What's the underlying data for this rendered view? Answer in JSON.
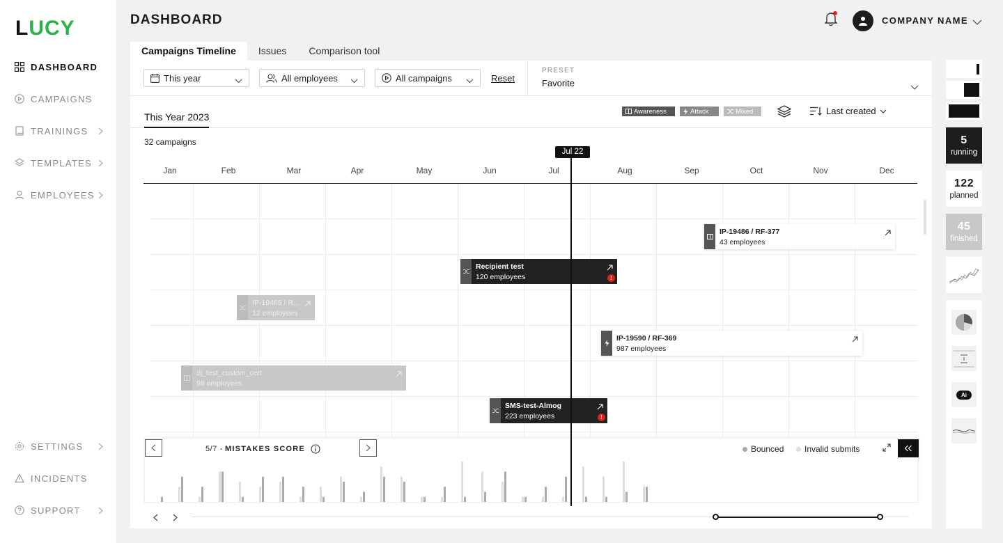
{
  "brand": {
    "logo_first": "L",
    "logo_rest": "UCY",
    "accent": "#2bb34a"
  },
  "sidebar": {
    "items": [
      {
        "label": "DASHBOARD",
        "icon": "grid-icon",
        "active": true
      },
      {
        "label": "CAMPAIGNS",
        "icon": "play-circle-icon"
      },
      {
        "label": "TRAININGS",
        "icon": "book-icon",
        "chevron": true
      },
      {
        "label": "TEMPLATES",
        "icon": "layers-icon",
        "chevron": true
      },
      {
        "label": "EMPLOYEES",
        "icon": "user-icon",
        "chevron": true
      }
    ],
    "bottom_items": [
      {
        "label": "SETTINGS",
        "icon": "gear-icon",
        "chevron": true
      },
      {
        "label": "INCIDENTS",
        "icon": "warning-icon"
      },
      {
        "label": "SUPPORT",
        "icon": "help-circle-icon",
        "chevron": true
      }
    ]
  },
  "header": {
    "title": "DASHBOARD",
    "company": "COMPANY NAME",
    "notification_dot_color": "#d9251c"
  },
  "tabs": [
    {
      "label": "Campaigns Timeline",
      "active": true
    },
    {
      "label": "Issues"
    },
    {
      "label": "Comparison tool"
    }
  ],
  "filters": {
    "period": "This year",
    "employees": "All employees",
    "campaigns": "All campaigns",
    "reset": "Reset",
    "preset_label": "PRESET",
    "preset_value": "Favorite"
  },
  "subheader": {
    "year_tab": "This Year 2023",
    "legend": [
      {
        "label": "Awareness",
        "color": "#555555"
      },
      {
        "label": "Attack",
        "color": "#888888"
      },
      {
        "label": "Mixed",
        "color": "#bbbbbb"
      }
    ],
    "sort": "Last created"
  },
  "timeline": {
    "count": "32 campaigns",
    "months": [
      "Jan",
      "Feb",
      "Mar",
      "Apr",
      "May",
      "Jun",
      "Jul",
      "Aug",
      "Sep",
      "Oct",
      "Nov",
      "Dec"
    ],
    "today": "Jul 22",
    "campaigns": [
      {
        "name": "IP-19486 / RF-377",
        "employees": "43 employees",
        "style": "white",
        "icon": "book-icon"
      },
      {
        "name": "Recipient test",
        "employees": "120 employees",
        "style": "dark",
        "icon": "shuffle-icon",
        "warning": "!"
      },
      {
        "name": "IP-19465 / R...",
        "employees": "12 employees",
        "style": "grey",
        "icon": "shuffle-icon"
      },
      {
        "name": "IP-19590 / RF-369",
        "employees": "987 employees",
        "style": "white",
        "icon": "bolt-icon"
      },
      {
        "name": "dj_test_custom_cert",
        "employees": "98 employees",
        "style": "grey",
        "icon": "book-icon"
      },
      {
        "name": "SMS-test-Almog",
        "employees": "223 employees",
        "style": "dark",
        "icon": "shuffle-icon",
        "warning": "!"
      }
    ]
  },
  "mistakes_panel": {
    "page": "5/7",
    "separator": "-",
    "title": "MISTAKES SCORE",
    "legend": [
      {
        "label": "Bounced",
        "color": "#aaaaaa"
      },
      {
        "label": "Invalid submits",
        "color": "#dddddd"
      }
    ]
  },
  "chart_data": {
    "type": "bar",
    "title": "MISTAKES SCORE",
    "series": [
      {
        "name": "Bounced",
        "values": [
          1,
          5,
          3,
          6,
          1,
          5,
          5,
          3,
          1,
          4,
          2,
          5,
          4,
          1,
          3,
          1,
          2,
          6,
          1,
          3,
          5,
          1,
          1,
          2,
          3
        ]
      },
      {
        "name": "Invalid submits",
        "values": [
          0,
          3,
          1,
          6,
          4,
          3,
          4,
          1,
          3,
          5,
          1,
          7,
          5,
          1,
          1,
          8,
          6,
          4,
          1,
          1,
          1,
          7,
          5,
          8,
          3
        ]
      }
    ]
  },
  "rail": {
    "running": {
      "value": "5",
      "label": "running"
    },
    "planned": {
      "value": "122",
      "label": "planned"
    },
    "finished": {
      "value": "45",
      "label": "finished"
    },
    "ai_badge": "Ai"
  }
}
